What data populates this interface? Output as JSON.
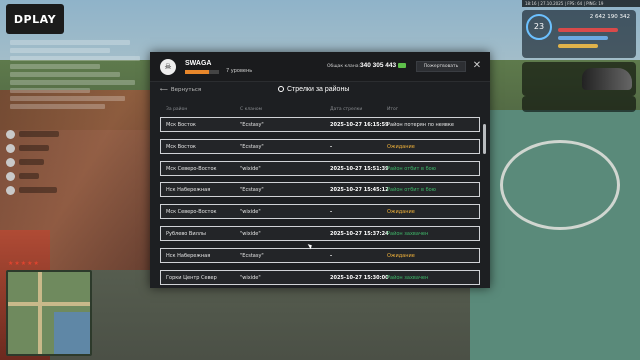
{
  "hud": {
    "server_logo": "DPLAY",
    "money": "2 642 190 342",
    "level": "23",
    "statusbar": "18:16 | 27.10.2025 | FPS: 64 | PING: 19"
  },
  "modal": {
    "clan_name": "SWAGA",
    "clan_level": "7 уровень",
    "clan_level_progress": 0.7,
    "wallet_label": "Общак клана:",
    "wallet_value": "340 305 443",
    "donate_label": "Пожертвовать",
    "close_label": "✕",
    "back_label": "Вернуться",
    "section_title": "Стрелки за районы",
    "columns": {
      "district": "За район",
      "opponent": "С кланом",
      "date": "Дата стрелки",
      "result": "Итог"
    },
    "rows": [
      {
        "district": "Мск Восток",
        "opponent": "\"Ecstasy\"",
        "date": "2025-10-27 16:15:59",
        "result": "Район потерян по неявке",
        "status": "lost"
      },
      {
        "district": "Мск Восток",
        "opponent": "\"Ecstasy\"",
        "date": "-",
        "result": "Ожидание",
        "status": "wait"
      },
      {
        "district": "Мск Северо-Восток",
        "opponent": "\"wixide\"",
        "date": "2025-10-27 15:51:39",
        "result": "Район отбит в бою",
        "status": "repelled"
      },
      {
        "district": "Нск Набережная",
        "opponent": "\"Ecstasy\"",
        "date": "2025-10-27 15:45:12",
        "result": "Район отбит в бою",
        "status": "repelled"
      },
      {
        "district": "Мск Северо-Восток",
        "opponent": "\"wixide\"",
        "date": "-",
        "result": "Ожидание",
        "status": "wait"
      },
      {
        "district": "Рублево Виллы",
        "opponent": "\"wixide\"",
        "date": "2025-10-27 15:37:24",
        "result": "Район захвачен",
        "status": "captured"
      },
      {
        "district": "Нск Набережная",
        "opponent": "\"Ecstasy\"",
        "date": "-",
        "result": "Ожидание",
        "status": "wait"
      },
      {
        "district": "Горки Центр Север",
        "opponent": "\"wixide\"",
        "date": "2025-10-27 15:30:00",
        "result": "Район захвачен",
        "status": "captured"
      }
    ]
  },
  "colors": {
    "accent": "#e8872b",
    "status_wait": "#f0b23a",
    "status_green": "#3fb86a"
  }
}
